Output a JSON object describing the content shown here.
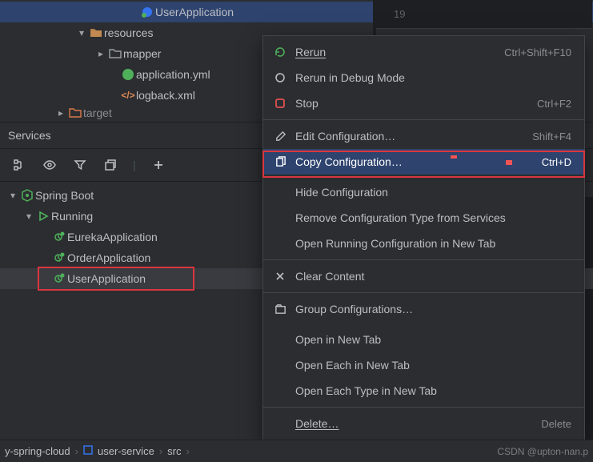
{
  "project_tree": {
    "user_application": "UserApplication",
    "resources": "resources",
    "mapper": "mapper",
    "app_yml": "application.yml",
    "logback": "logback.xml",
    "target": "target"
  },
  "gutter_line": "19",
  "services": {
    "title": "Services",
    "spring_boot": "Spring Boot",
    "running": "Running",
    "apps": {
      "eureka": "EurekaApplication",
      "order": "OrderApplication",
      "user": "UserApplication"
    }
  },
  "menu": {
    "rerun": {
      "label": "Rerun",
      "shortcut": "Ctrl+Shift+F10"
    },
    "rerun_debug": {
      "label": "Rerun in Debug Mode",
      "shortcut": ""
    },
    "stop": {
      "label": "Stop",
      "shortcut": "Ctrl+F2"
    },
    "edit": {
      "label": "Edit Configuration…",
      "shortcut": "Shift+F4"
    },
    "copy": {
      "label": "Copy Configuration…",
      "shortcut": "Ctrl+D"
    },
    "hide": {
      "label": "Hide Configuration"
    },
    "remove_type": {
      "label": "Remove Configuration Type from Services"
    },
    "open_tab": {
      "label": "Open Running Configuration in New Tab"
    },
    "clear": {
      "label": "Clear Content"
    },
    "group": {
      "label": "Group Configurations…"
    },
    "open_new": {
      "label": "Open in New Tab"
    },
    "open_each": {
      "label": "Open Each in New Tab"
    },
    "open_each_type": {
      "label": "Open Each Type in New Tab"
    },
    "delete": {
      "label": "Delete…",
      "shortcut": "Delete"
    }
  },
  "breadcrumb": {
    "a": "y-spring-cloud",
    "b": "user-service",
    "c": "src"
  },
  "watermark": "CSDN @upton-nan.p"
}
